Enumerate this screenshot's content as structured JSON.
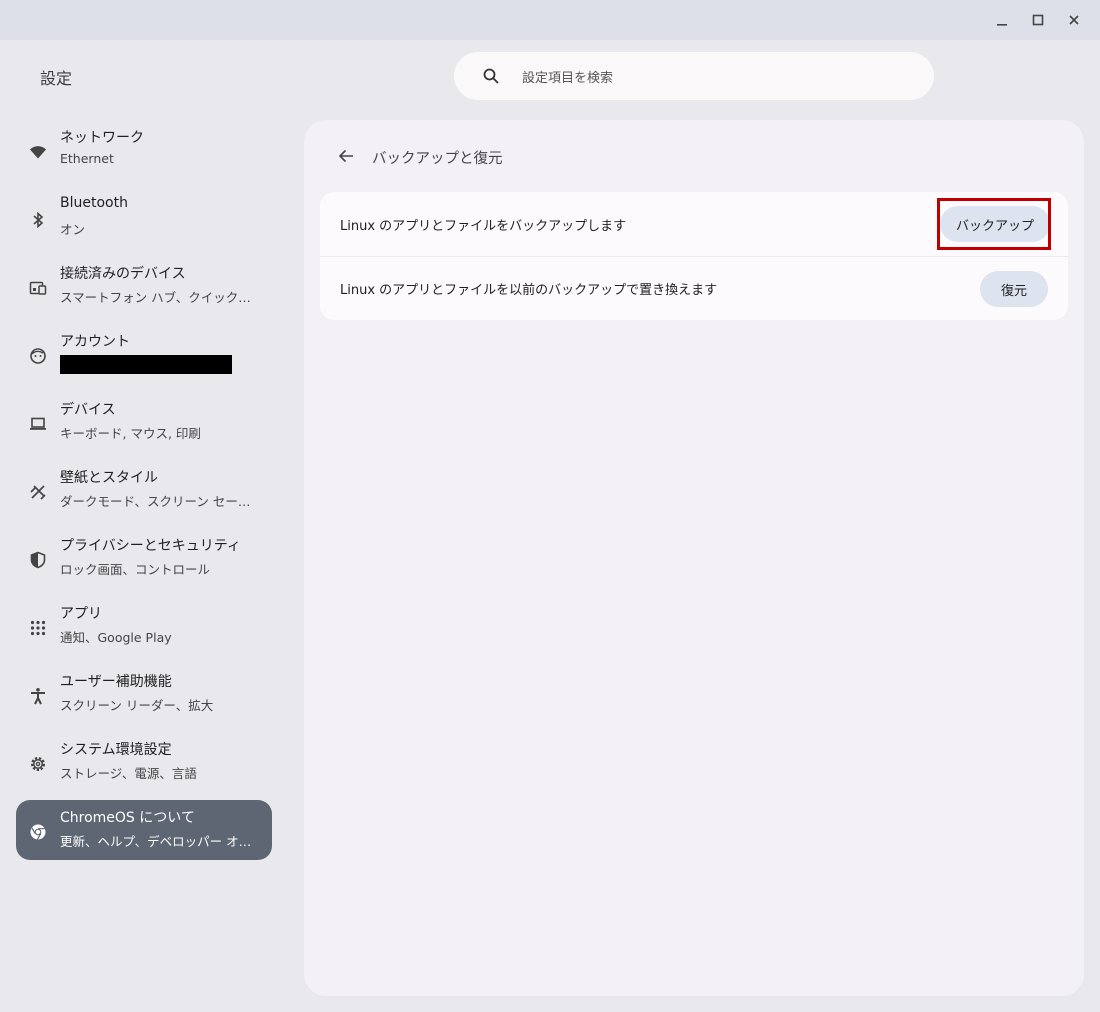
{
  "window": {
    "minimize_icon": "minimize-icon",
    "maximize_icon": "maximize-icon",
    "close_icon": "close-icon"
  },
  "app": {
    "title": "設定"
  },
  "search": {
    "placeholder": "設定項目を検索",
    "icon": "search-icon"
  },
  "sidebar": {
    "items": [
      {
        "label": "ネットワーク",
        "sublabel": "Ethernet",
        "icon": "wifi-icon"
      },
      {
        "label": "Bluetooth",
        "sublabel": "オン",
        "icon": "bluetooth-icon"
      },
      {
        "label": "接続済みのデバイス",
        "sublabel": "スマートフォン ハブ、クイック…",
        "icon": "connected-devices-icon"
      },
      {
        "label": "アカウント",
        "sublabel": "",
        "icon": "account-icon"
      },
      {
        "label": "デバイス",
        "sublabel": "キーボード, マウス, 印刷",
        "icon": "laptop-icon"
      },
      {
        "label": "壁紙とスタイル",
        "sublabel": "ダークモード、スクリーン セー…",
        "icon": "palette-icon"
      },
      {
        "label": "プライバシーとセキュリティ",
        "sublabel": "ロック画面、コントロール",
        "icon": "shield-icon"
      },
      {
        "label": "アプリ",
        "sublabel": "通知、Google Play",
        "icon": "apps-grid-icon"
      },
      {
        "label": "ユーザー補助機能",
        "sublabel": "スクリーン リーダー、拡大",
        "icon": "accessibility-icon"
      },
      {
        "label": "システム環境設定",
        "sublabel": "ストレージ、電源、言語",
        "icon": "gear-icon"
      },
      {
        "label": "ChromeOS について",
        "sublabel": "更新、ヘルプ、デベロッパー オ…",
        "icon": "chrome-icon"
      }
    ],
    "active_index": 10
  },
  "main": {
    "title": "バックアップと復元",
    "rows": [
      {
        "text": "Linux のアプリとファイルをバックアップします",
        "button": "バックアップ"
      },
      {
        "text": "Linux のアプリとファイルを以前のバックアップで置き換えます",
        "button": "復元"
      }
    ]
  },
  "colors": {
    "highlight": "#c00000",
    "active_nav": "#5f6673",
    "button_bg": "#dde3ef"
  }
}
